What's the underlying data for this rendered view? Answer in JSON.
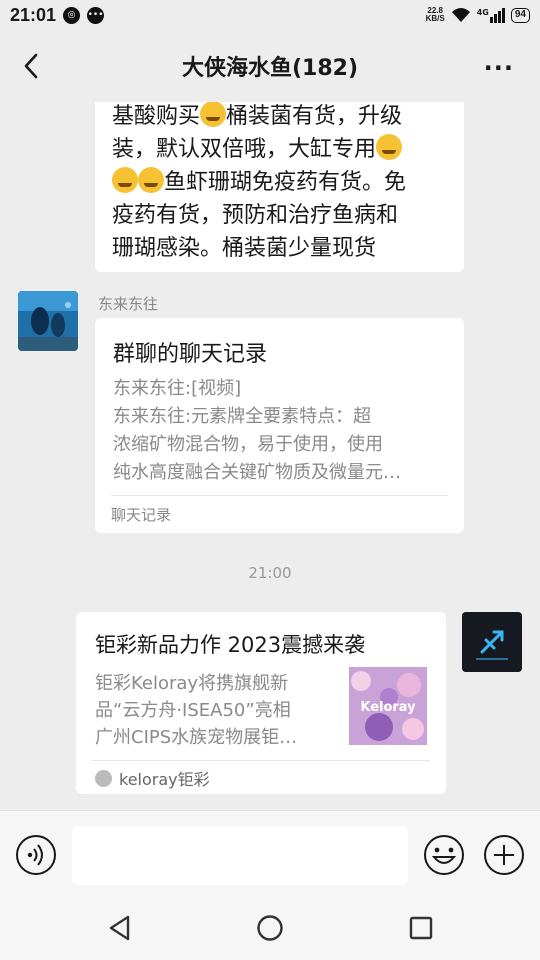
{
  "status_bar": {
    "time": "21:01",
    "net_speed_value": "22.8",
    "net_speed_unit": "KB/S",
    "network": "4G",
    "battery": "94"
  },
  "header": {
    "title": "大侠海水鱼(182)",
    "back_icon": "back-arrow-icon",
    "more_icon": "more-dots-icon"
  },
  "messages": {
    "text_message": {
      "line1_a": "基酸购买",
      "line1_b": "桶装菌有货，升级",
      "line2_a": "装，默认双倍哦，大缸专用",
      "line3_b": "鱼虾珊瑚免疫药有货。免",
      "line4": "疫药有货，预防和治疗鱼病和",
      "line5": "珊瑚感染。桶装菌少量现货"
    },
    "chat_record": {
      "sender": "东来东往",
      "title": "群聊的聊天记录",
      "lines": [
        "东来东往:[视频]",
        "东来东往:元素牌全要素特点：超",
        "浓缩矿物混合物，易于使用，使用",
        "纯水高度融合关键矿物质及微量元…"
      ],
      "footer": "聊天记录"
    },
    "timestamp": "21:00",
    "link_card": {
      "title": "钜彩新品力作 2023震撼来袭",
      "desc_lines": [
        "钜彩Keloray将携旗舰新",
        "品“云方舟·ISEA50”亮相",
        "广州CIPS水族宠物展钜…"
      ],
      "thumb_text": "Keloray",
      "source": "keloray钜彩"
    }
  },
  "input_bar": {
    "voice_icon": "voice-icon",
    "emoji_icon": "emoji-icon",
    "plus_icon": "plus-icon",
    "input_value": ""
  },
  "colors": {
    "background": "#ededed",
    "bubble": "#ffffff",
    "secondary_text": "#8a8a8a"
  }
}
